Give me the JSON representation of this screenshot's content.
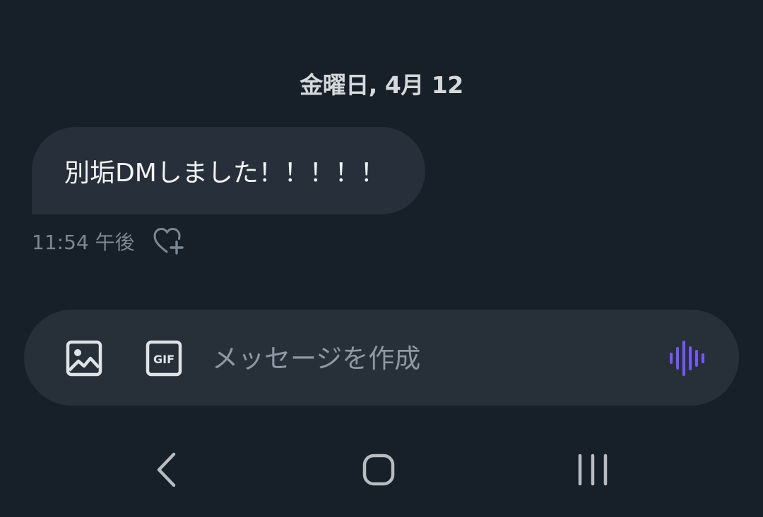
{
  "conversation": {
    "date_separator": "金曜日, 4月 12",
    "messages": [
      {
        "text": "別垢DMしました！！！！！",
        "timestamp": "11:54 午後"
      }
    ]
  },
  "composer": {
    "placeholder": "メッセージを作成",
    "value": "",
    "media_icon": "image-icon",
    "gif_icon": "gif-icon",
    "gif_label": "GIF",
    "voice_icon": "voice-waveform-icon"
  },
  "navigation_bar": {
    "items": [
      "back-icon",
      "home-icon",
      "recents-icon"
    ]
  },
  "colors": {
    "background": "#171f28",
    "bubble": "#262f3a",
    "composer": "#273039",
    "voice_accent": "#7856ff",
    "muted_text": "#7b8894"
  }
}
